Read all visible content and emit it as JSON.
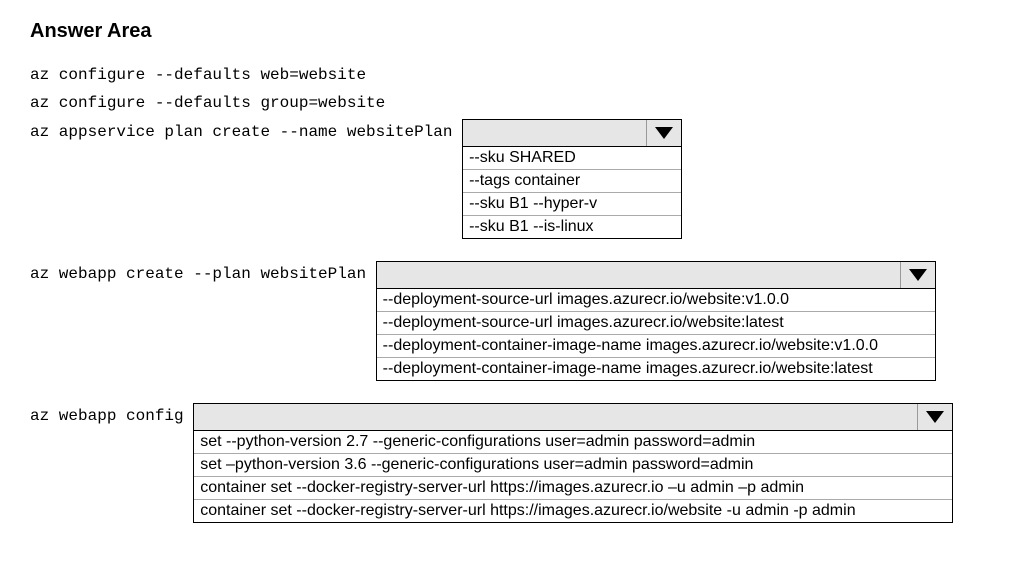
{
  "title": "Answer Area",
  "lines": {
    "l1": "az configure --defaults web=website",
    "l2": "az configure --defaults group=website",
    "l3": "az appservice plan create --name websitePlan ",
    "l4": "az webapp create --plan websitePlan ",
    "l5": "az webapp config "
  },
  "dropdown1": {
    "options": [
      "--sku SHARED",
      "--tags container",
      "--sku B1 --hyper-v",
      "--sku B1 --is-linux"
    ]
  },
  "dropdown2": {
    "options": [
      "--deployment-source-url images.azurecr.io/website:v1.0.0",
      "--deployment-source-url images.azurecr.io/website:latest",
      "--deployment-container-image-name images.azurecr.io/website:v1.0.0",
      "--deployment-container-image-name images.azurecr.io/website:latest"
    ]
  },
  "dropdown3": {
    "options": [
      "set --python-version 2.7 --generic-configurations user=admin password=admin",
      "set –python-version 3.6 --generic-configurations user=admin password=admin",
      "container set --docker-registry-server-url https://images.azurecr.io –u admin –p admin",
      "container set --docker-registry-server-url https://images.azurecr.io/website -u admin -p admin"
    ]
  }
}
